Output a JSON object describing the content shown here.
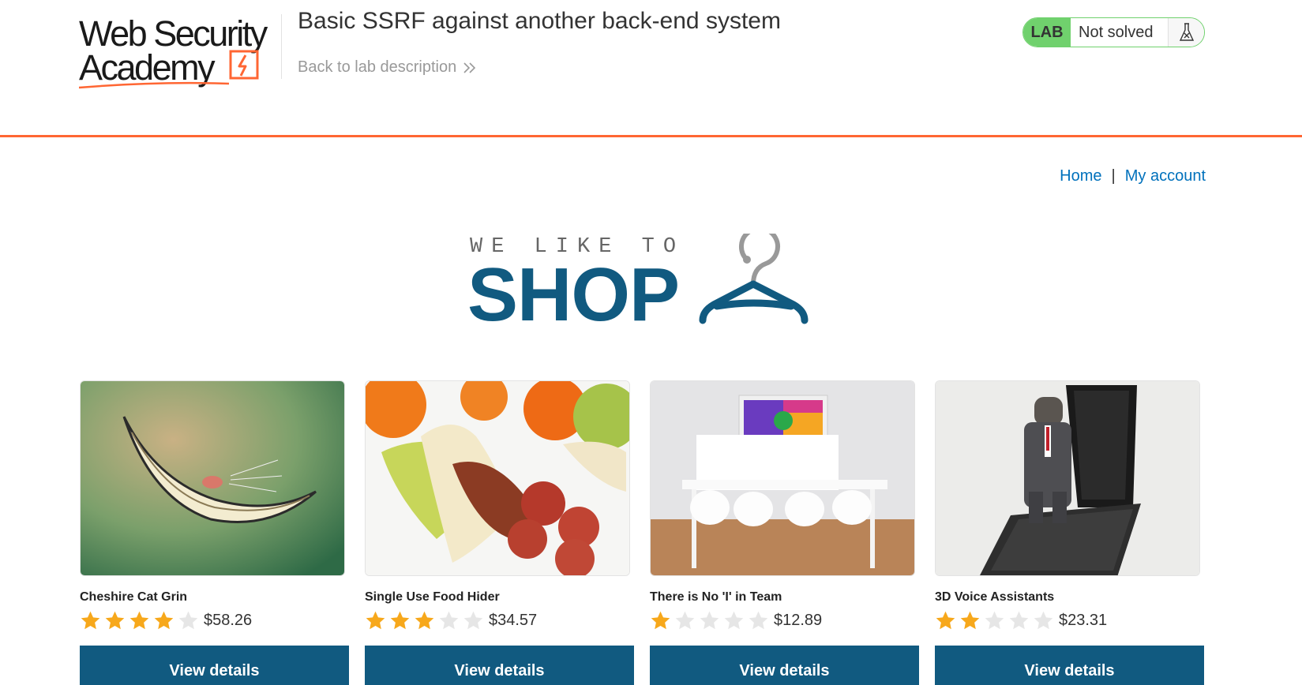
{
  "academy": {
    "logo_line1": "Web Security",
    "logo_line2": "Academy",
    "lab_title": "Basic SSRF against another back-end system",
    "back_link": "Back to lab description",
    "lab_badge": {
      "label": "LAB",
      "status": "Not solved"
    },
    "colors": {
      "accent": "#ff6633",
      "lab_green": "#70d16d"
    }
  },
  "nav": {
    "home": "Home",
    "separator": "|",
    "account": "My account"
  },
  "banner": {
    "small_text": "WE LIKE TO",
    "big_text": "SHOP"
  },
  "products": [
    {
      "name": "Cheshire Cat Grin",
      "price": "$58.26",
      "rating": 4,
      "image": "cheshire-cat-grin",
      "button": "View details"
    },
    {
      "name": "Single Use Food Hider",
      "price": "$34.57",
      "rating": 3,
      "image": "food-hider",
      "button": "View details"
    },
    {
      "name": "There is No 'I' in Team",
      "price": "$12.89",
      "rating": 1,
      "image": "team-table",
      "button": "View details"
    },
    {
      "name": "3D Voice Assistants",
      "price": "$23.31",
      "rating": 2,
      "image": "voice-assistant-phone",
      "button": "View details"
    }
  ],
  "rating_max": 5,
  "colors": {
    "link": "#0071bc",
    "primary": "#115a80",
    "star_on": "#f7a81b",
    "star_off": "#e6e6e6"
  },
  "icons": {
    "back": "double-chevron-right-icon",
    "lab": "flask-icon",
    "star": "star-icon",
    "hanger": "hanger-icon"
  }
}
